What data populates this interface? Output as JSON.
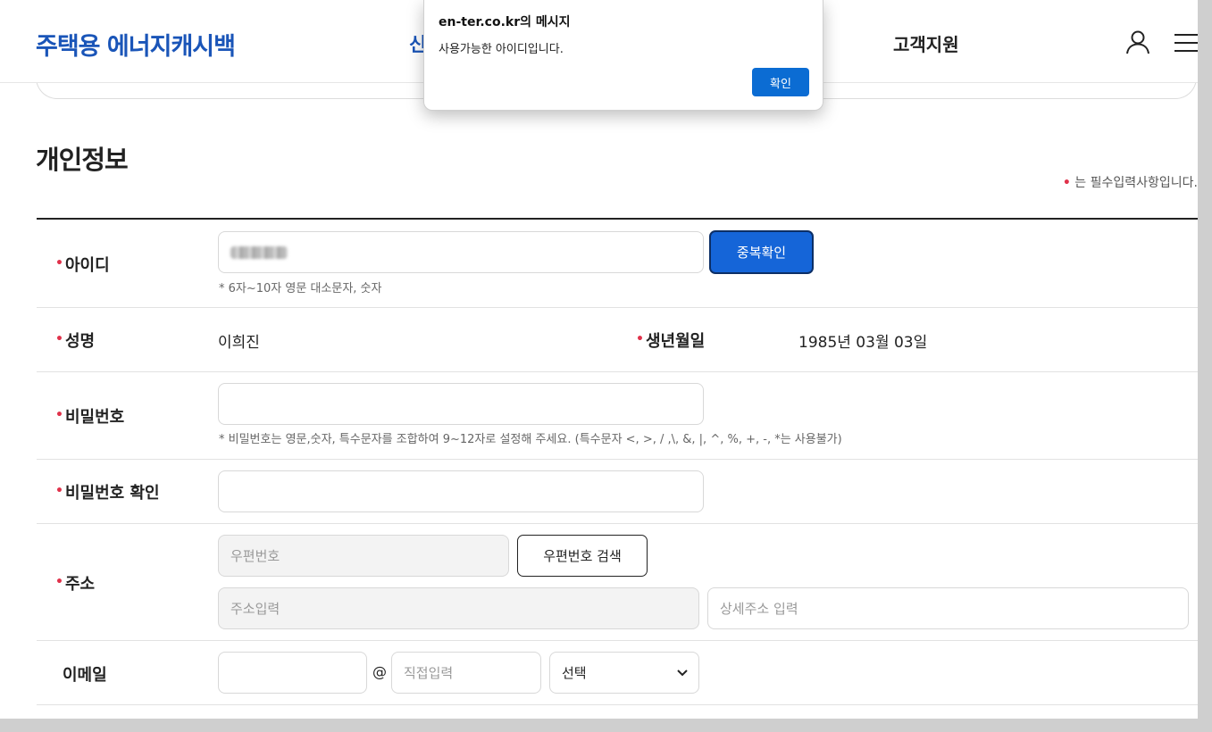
{
  "header": {
    "logo": "주택용 에너지캐시백",
    "nav_partial": "신",
    "nav_support": "고객지원"
  },
  "dialog": {
    "title": "en-ter.co.kr의 메시지",
    "message": "사용가능한 아이디입니다.",
    "ok_label": "확인"
  },
  "section": {
    "title": "개인정보",
    "required_mark": "•",
    "required_note": "는 필수입력사항입니다."
  },
  "form": {
    "id": {
      "label": "아이디",
      "button": "중복확인",
      "hint": "* 6자~10자 영문 대소문자, 숫자"
    },
    "name": {
      "label": "성명",
      "value": "이희진"
    },
    "birth": {
      "label": "생년월일",
      "value": "1985년 03월 03일"
    },
    "password": {
      "label": "비밀번호",
      "hint": "* 비밀번호는 영문,숫자, 특수문자를 조합하여 9~12자로 설정해 주세요. (특수문자 <, >, / ,\\, &, |, ^, %, +, -, *는 사용불가)"
    },
    "password_confirm": {
      "label": "비밀번호 확인"
    },
    "address": {
      "label": "주소",
      "zipcode_placeholder": "우편번호",
      "search_button": "우편번호 검색",
      "address_placeholder": "주소입력",
      "detail_placeholder": "상세주소 입력"
    },
    "email": {
      "label": "이메일",
      "at": "@",
      "domain_placeholder": "직접입력",
      "select_value": "선택"
    }
  },
  "colors": {
    "brand": "#1a55b8",
    "primary_button": "#1565d8",
    "required": "#e0324b",
    "dialog_button": "#0b6cd3"
  }
}
